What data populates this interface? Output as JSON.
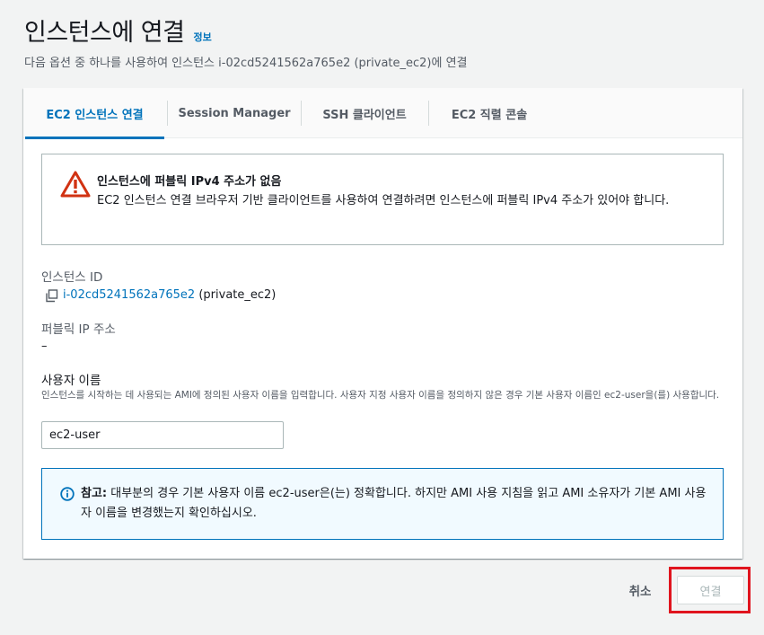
{
  "header": {
    "title": "인스턴스에 연결",
    "info_link": "정보",
    "subtitle": "다음 옵션 중 하나를 사용하여 인스턴스 i-02cd5241562a765e2 (private_ec2)에 연결"
  },
  "tabs": [
    {
      "label": "EC2 인스턴스 연결",
      "active": true
    },
    {
      "label": "Session Manager",
      "active": false
    },
    {
      "label": "SSH 클라이언트",
      "active": false
    },
    {
      "label": "EC2 직렬 콘솔",
      "active": false
    }
  ],
  "warning_alert": {
    "icon": "warning-triangle-icon",
    "title": "인스턴스에 퍼블릭 IPv4 주소가 없음",
    "body": "EC2 인스턴스 연결 브라우저 기반 클라이언트를 사용하여 연결하려면 인스턴스에 퍼블릭 IPv4 주소가 있어야 합니다."
  },
  "instance_id": {
    "label": "인스턴스 ID",
    "value": "i-02cd5241562a765e2",
    "suffix": "(private_ec2)"
  },
  "public_ip": {
    "label": "퍼블릭 IP 주소",
    "value": "–"
  },
  "username": {
    "label": "사용자 이름",
    "description": "인스턴스를 시작하는 데 사용되는 AMI에 정의된 사용자 이름을 입력합니다. 사용자 지정 사용자 이름을 정의하지 않은 경우 기본 사용자 이름인 ec2-user을(를) 사용합니다.",
    "value": "ec2-user"
  },
  "info_alert": {
    "icon": "info-circle-icon",
    "bold_prefix": "참고:",
    "text": " 대부분의 경우 기본 사용자 이름 ec2-user은(는) 정확합니다. 하지만 AMI 사용 지침을 읽고 AMI 소유자가 기본 AMI 사용자 이름을 변경했는지 확인하십시오."
  },
  "footer": {
    "cancel_label": "취소",
    "connect_label": "연결",
    "connect_disabled": true,
    "highlight_color": "#e0141e"
  },
  "colors": {
    "accent": "#0073bb",
    "warning": "#d13212",
    "background": "#f2f3f3"
  }
}
